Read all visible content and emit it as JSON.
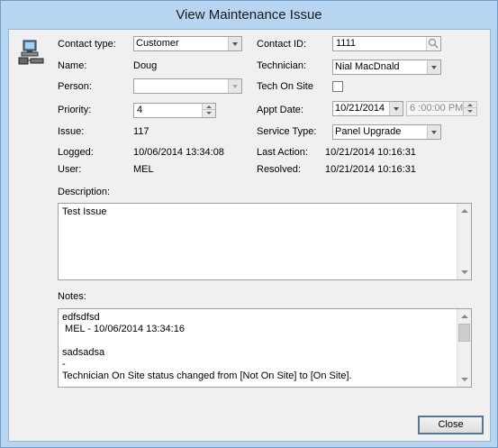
{
  "window": {
    "title": "View Maintenance Issue"
  },
  "icons": {
    "contact": "computer-network-icon",
    "search": "search-icon"
  },
  "labels": {
    "contact_type": "Contact type:",
    "name": "Name:",
    "person": "Person:",
    "priority": "Priority:",
    "issue": "Issue:",
    "logged": "Logged:",
    "user": "User:",
    "contact_id": "Contact ID:",
    "technician": "Technician:",
    "tech_on_site": "Tech On Site",
    "appt_date": "Appt Date:",
    "service_type": "Service Type:",
    "last_action": "Last Action:",
    "resolved": "Resolved:",
    "description": "Description:",
    "notes": "Notes:"
  },
  "values": {
    "contact_type": "Customer",
    "name": "Doug",
    "person": "",
    "priority": "4",
    "issue": "117",
    "logged": "10/06/2014 13:34:08",
    "user": "MEL",
    "contact_id": "1111",
    "technician": "Nial MacDnald",
    "tech_on_site": false,
    "appt_date": "10/21/2014",
    "appt_time": "6 :00:00 PM",
    "service_type": "Panel Upgrade",
    "last_action": "10/21/2014 10:16:31",
    "resolved": "10/21/2014 10:16:31"
  },
  "description": {
    "text": "Test Issue"
  },
  "notes": {
    "text": "edfsdfsd\n MEL - 10/06/2014 13:34:16\n\nsadsadsa\n-\nTechnician On Site status changed from [Not On Site] to [On Site]."
  },
  "buttons": {
    "close": "Close"
  }
}
